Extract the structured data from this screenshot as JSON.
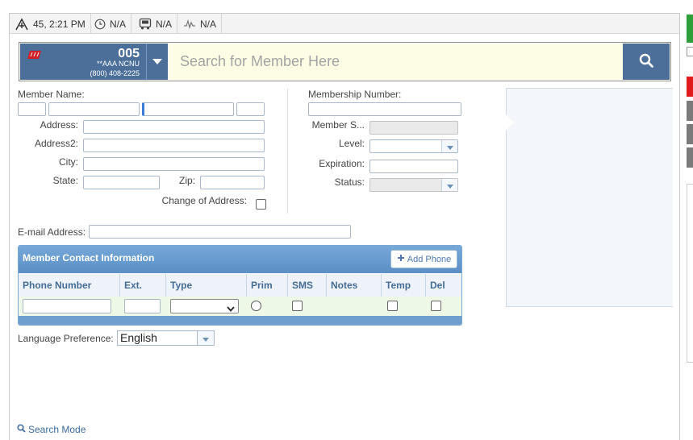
{
  "statusbar": {
    "coords": "45, 2:21 PM",
    "timer_value": "N/A",
    "vehicle_value": "N/A",
    "signal_value": "N/A"
  },
  "club": {
    "number": "005",
    "name": "**AAA NCNU",
    "phone": "(800) 408-2225"
  },
  "search": {
    "placeholder": "Search for Member Here"
  },
  "member_form": {
    "member_name_label": "Member Name:",
    "address_label": "Address:",
    "address2_label": "Address2:",
    "city_label": "City:",
    "state_label": "State:",
    "zip_label": "Zip:",
    "change_of_address_label": "Change of Address:",
    "membership_number_label": "Membership Number:",
    "member_since_label": "Member S...",
    "level_label": "Level:",
    "expiration_label": "Expiration:",
    "status_label": "Status:",
    "email_label": "E-mail Address:"
  },
  "contact": {
    "title": "Member Contact Information",
    "add_phone_label": "Add Phone",
    "columns": [
      "Phone Number",
      "Ext.",
      "Type",
      "Prim",
      "SMS",
      "Notes",
      "Temp",
      "Del"
    ]
  },
  "language": {
    "label": "Language Preference:",
    "value": "English"
  },
  "footer": {
    "search_mode_label": "Search Mode"
  },
  "colors": {
    "accent": "#4b6f99",
    "search_bg": "#fdfde6",
    "contact_header": "#5b8fc5",
    "row_bg": "#eef8e6"
  }
}
